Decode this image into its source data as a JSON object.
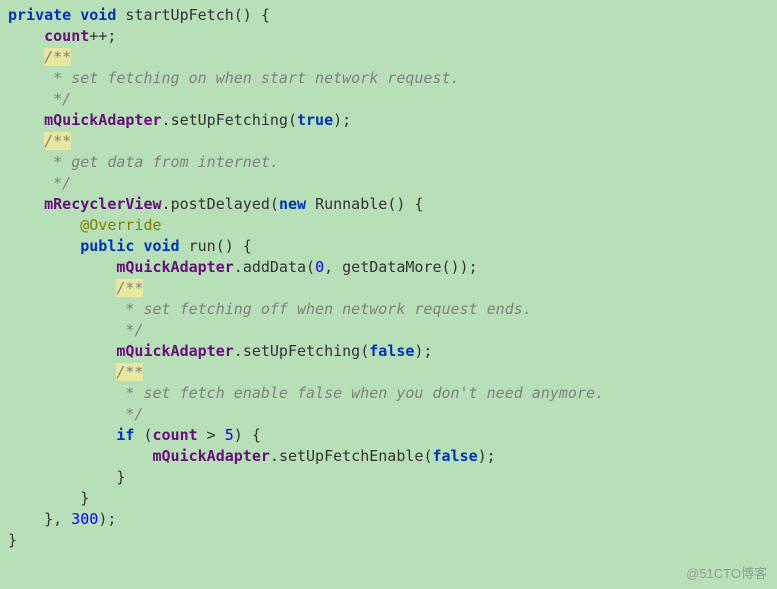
{
  "code": {
    "kw_private": "private",
    "kw_void": "void",
    "kw_public": "public",
    "kw_new": "new",
    "kw_if": "if",
    "kw_true": "true",
    "kw_false": "false",
    "method_startUpFetch": "startUpFetch",
    "method_setUpFetching": "setUpFetching",
    "method_postDelayed": "postDelayed",
    "method_run": "run",
    "method_addData": "addData",
    "method_getDataMore": "getDataMore",
    "method_setUpFetchEnable": "setUpFetchEnable",
    "field_count": "count",
    "field_mQuickAdapter": "mQuickAdapter",
    "field_mRecyclerView": "mRecyclerView",
    "class_Runnable": "Runnable",
    "annotation_Override": "@Override",
    "comment_marker": "/**",
    "comment_end": " */",
    "comment1_line": " * set fetching on when start network request.",
    "comment2_line": " * get data from internet.",
    "comment3_line": " * set fetching off when network request ends.",
    "comment4_line": " * set fetch enable false when you don't need anymore.",
    "num_0": "0",
    "num_5": "5",
    "num_300": "300",
    "op_increment": "++;",
    "paren_open_brace": "() {",
    "dot": ".",
    "open_paren": "(",
    "close_paren_semi": ");",
    "close_paren_brace": "() {",
    "close_brace": "}",
    "comma_space": ", ",
    "close_paren_paren_semi": "());",
    "gt": " > ",
    "close_paren_sp_brace": ") {",
    "close_brace_comma": "}, "
  },
  "watermark": "@51CTO博客"
}
